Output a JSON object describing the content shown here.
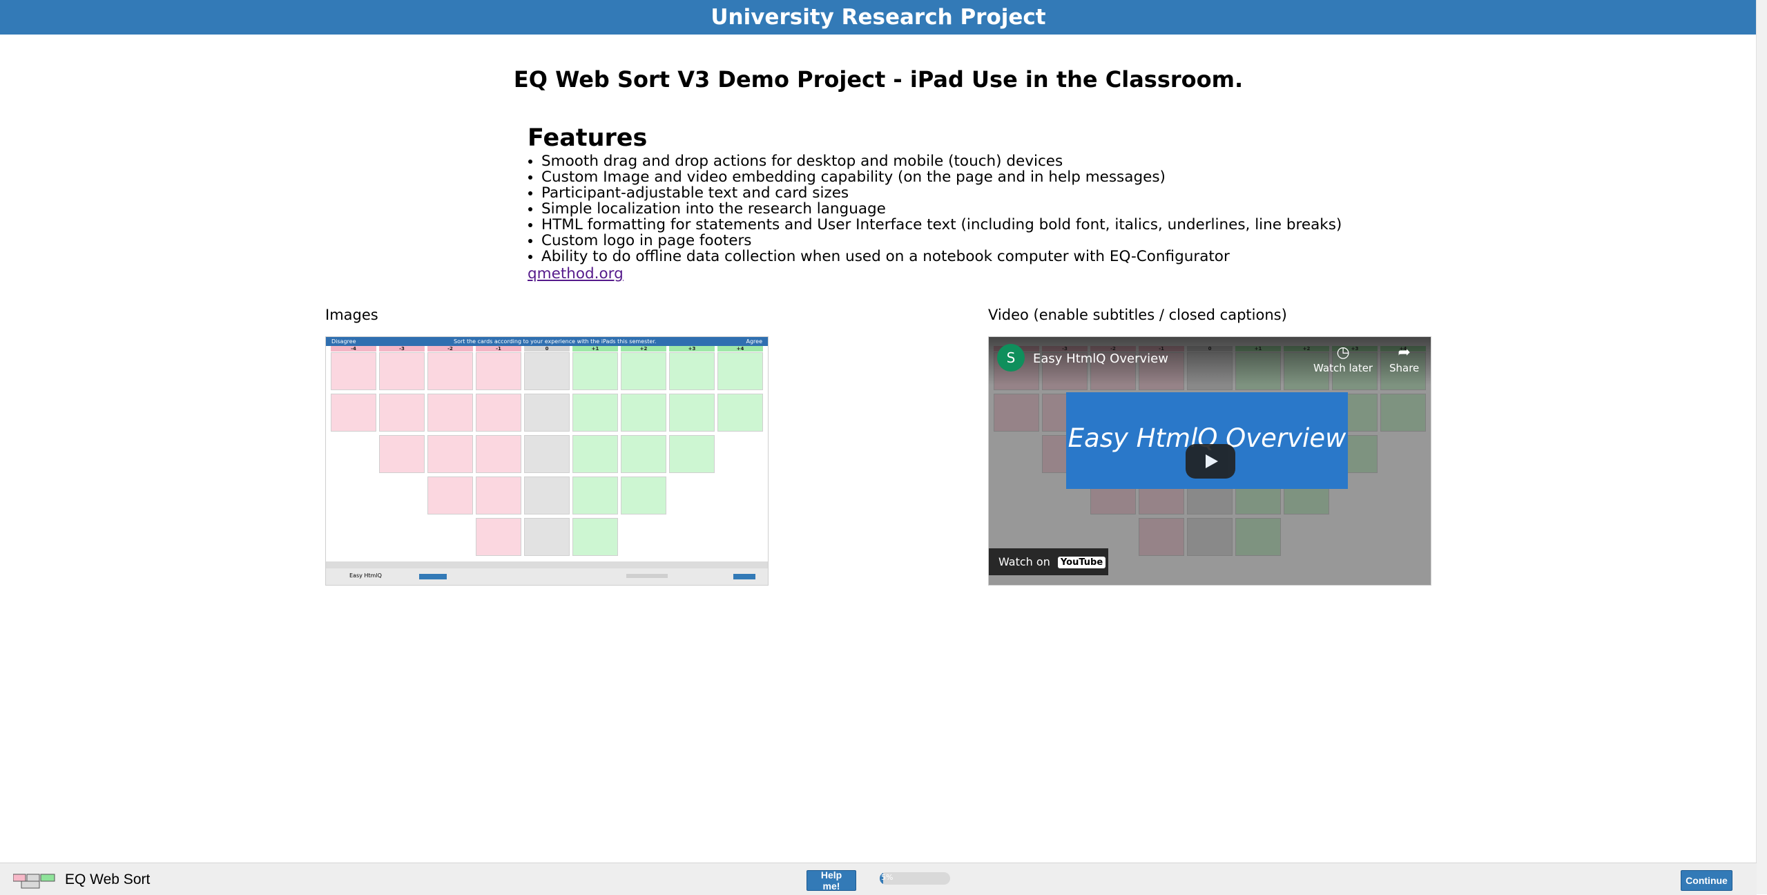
{
  "header": {
    "title": "University Research Project"
  },
  "main": {
    "title": "EQ Web Sort V3 Demo Project - iPad Use in the Classroom.",
    "features": {
      "heading": "Features",
      "items": [
        "Smooth drag and drop actions for desktop and mobile (touch) devices",
        "Custom Image and video embedding capability (on the page and in help messages)",
        "Participant-adjustable text and card sizes",
        "Simple localization into the research language",
        "HTML formatting for statements and User Interface text (including bold font, italics, underlines, line breaks)",
        "Custom logo in page footers",
        "Ability to do offline data collection when used on a notebook computer with EQ-Configurator"
      ],
      "link": "qmethod.org"
    },
    "images_label": "Images",
    "video_label": "Video (enable subtitles / closed captions)",
    "sort_preview": {
      "disagree": "Disagree",
      "instruction": "Sort the cards according to your experience with the iPads this semester.",
      "agree": "Agree",
      "columns": [
        "-4",
        "-3",
        "-2",
        "-1",
        "0",
        "+1",
        "+2",
        "+3",
        "+4"
      ],
      "footer_brand": "Easy HtmlQ"
    },
    "video": {
      "channel_initial": "S",
      "title": "Easy HtmlQ Overview",
      "watch_later": "Watch later",
      "share": "Share",
      "banner_text": "Easy HtmlQ Overview",
      "watch_on": "Watch on",
      "youtube": "YouTube"
    }
  },
  "footer": {
    "brand": "EQ Web Sort",
    "help_button": "Help me!",
    "progress_percent": 5,
    "progress_text": "5%",
    "continue_button": "Continue"
  },
  "colors": {
    "brand_blue": "#337ab7",
    "card_pink": "#fbd7e0",
    "card_grey": "#e2e2e2",
    "card_green": "#cdf6d2"
  }
}
